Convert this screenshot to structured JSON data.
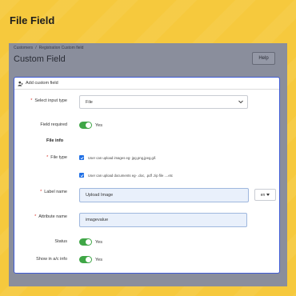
{
  "page": {
    "heading": "File Field"
  },
  "screen": {
    "breadcrumb": [
      "Customers",
      "Registration Custom field"
    ],
    "breadcrumb_sep": "/",
    "title": "Custom Field",
    "help_label": "Help"
  },
  "modal": {
    "header_icon": "add-user-icon",
    "header": "Add custom field",
    "input_type": {
      "label": "Select input type",
      "value": "File",
      "required": true
    },
    "field_required": {
      "label": "Field required",
      "state": "Yes",
      "on": true
    },
    "file_info": "File info",
    "file_type": {
      "label": "File type",
      "required": true,
      "options": [
        {
          "text": "User can upload images eg- jpg,png,jpeg,gif.",
          "checked": true
        },
        {
          "text": "User can upload documents eg- .doc, .pdf .zip file ....etc",
          "checked": true
        }
      ]
    },
    "label_name": {
      "label": "Label name",
      "value": "Upload Image",
      "required": true,
      "lang": "en"
    },
    "attribute_name": {
      "label": "Attribute name",
      "value": "imagevalue",
      "required": true
    },
    "status": {
      "label": "Status",
      "state": "Yes",
      "on": true
    },
    "show_in_ac": {
      "label": "Show in a/c info",
      "state": "Yes",
      "on": true
    },
    "required_mark": "*"
  },
  "colors": {
    "background": "#f6c93d",
    "accent": "#3e5bd6",
    "toggle_on": "#3fa646",
    "checkbox": "#1f6fe5",
    "required": "#d93025"
  }
}
